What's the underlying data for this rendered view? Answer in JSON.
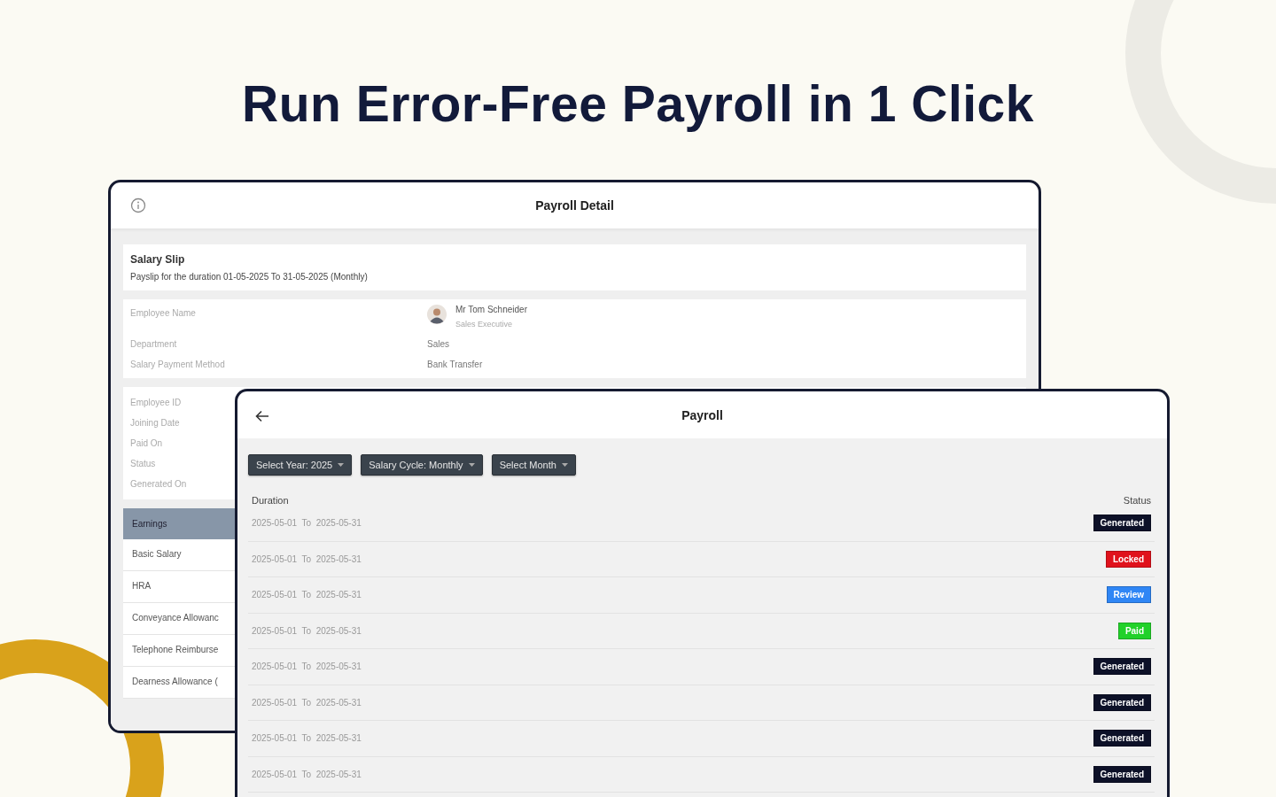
{
  "headline": "Run Error-Free Payroll in 1 Click",
  "payroll_detail": {
    "title": "Payroll Detail",
    "salary_slip": {
      "title": "Salary Slip",
      "subtitle": "Payslip for the duration 01-05-2025 To 31-05-2025 (Monthly)"
    },
    "employee_fields": [
      {
        "kind": "person",
        "label": "Employee Name",
        "name": "Mr Tom Schneider",
        "role": "Sales Executive"
      },
      {
        "kind": "text",
        "label": "Department",
        "value": "Sales"
      },
      {
        "kind": "text",
        "label": "Salary Payment Method",
        "value": "Bank Transfer"
      }
    ],
    "detail_labels": [
      "Employee ID",
      "Joining Date",
      "Paid On",
      "Status",
      "Generated On"
    ],
    "earnings": {
      "header": "Earnings",
      "rows": [
        "Basic Salary",
        "HRA",
        "Conveyance Allowanc",
        "Telephone Reimburse",
        "Dearness Allowance ("
      ]
    }
  },
  "payroll": {
    "title": "Payroll",
    "filters": [
      "Select Year: 2025",
      "Salary Cycle: Monthly",
      "Select Month"
    ],
    "columns": [
      "Duration",
      "Status"
    ],
    "rows": [
      {
        "duration": "2025-05-01  To  2025-05-31",
        "status": "Generated",
        "color": "#0d1128"
      },
      {
        "duration": "2025-05-01  To  2025-05-31",
        "status": "Locked",
        "color": "#e0121c"
      },
      {
        "duration": "2025-05-01  To  2025-05-31",
        "status": "Review",
        "color": "#2f86f5"
      },
      {
        "duration": "2025-05-01  To  2025-05-31",
        "status": "Paid",
        "color": "#22d12a"
      },
      {
        "duration": "2025-05-01  To  2025-05-31",
        "status": "Generated",
        "color": "#0d1128"
      },
      {
        "duration": "2025-05-01  To  2025-05-31",
        "status": "Generated",
        "color": "#0d1128"
      },
      {
        "duration": "2025-05-01  To  2025-05-31",
        "status": "Generated",
        "color": "#0d1128"
      },
      {
        "duration": "2025-05-01  To  2025-05-31",
        "status": "Generated",
        "color": "#0d1128"
      }
    ]
  }
}
